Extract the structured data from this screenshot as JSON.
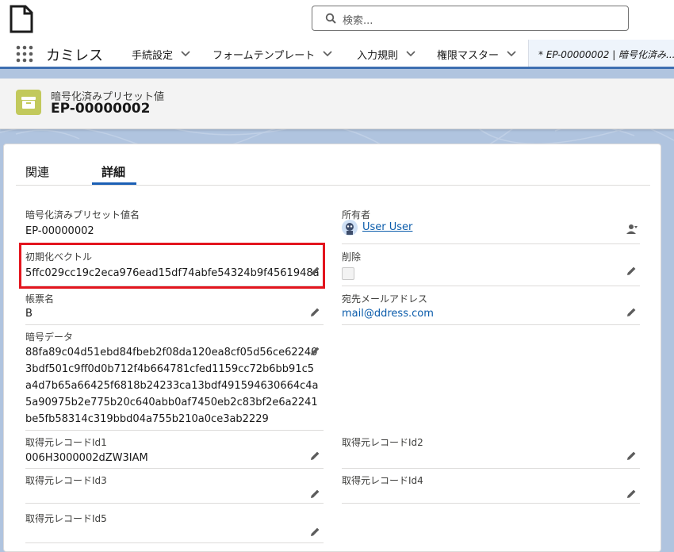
{
  "search": {
    "placeholder": "検索..."
  },
  "nav": {
    "app_name": "カミレス",
    "items": [
      {
        "label": "手続設定"
      },
      {
        "label": "フォームテンプレート"
      },
      {
        "label": "入力規則"
      },
      {
        "label": "権限マスター"
      }
    ],
    "active_tab": "* EP-00000002 | 暗号化済み..."
  },
  "record": {
    "object_label": "暗号化済みプリセット値",
    "name": "EP-00000002"
  },
  "tabs": [
    {
      "label": "関連"
    },
    {
      "label": "詳細"
    }
  ],
  "fields": {
    "preset_name": {
      "label": "暗号化済みプリセット値名",
      "value": "EP-00000002"
    },
    "owner": {
      "label": "所有者",
      "value": "User User"
    },
    "init_vector": {
      "label": "初期化ベクトル",
      "value": "5ffc029cc19c2eca976ead15df74abfe54324b9f4561948a"
    },
    "deleted": {
      "label": "削除"
    },
    "form_name": {
      "label": "帳票名",
      "value": "B"
    },
    "dest_email": {
      "label": "宛先メールアドレス",
      "value": "mail@ddress.com"
    },
    "encrypted_data": {
      "label": "暗号データ",
      "lines": [
        "88fa89c04d51ebd84fbeb2f08da120ea8cf05d56ce62240",
        "3bdf501c9ff0d0b712f4b664781cfed1159cc72b6bb91c5",
        "a4d7b65a66425f6818b24233ca13bdf491594630664c4a",
        "5a90975b2e775b20c640abb0af7450eb2c83bf2e6a2241",
        "be5fb58314c319bbd04a755b210a0ce3ab2229"
      ]
    },
    "source_id1": {
      "label": "取得元レコードId1",
      "value": "006H3000002dZW3IAM"
    },
    "source_id2": {
      "label": "取得元レコードId2"
    },
    "source_id3": {
      "label": "取得元レコードId3"
    },
    "source_id4": {
      "label": "取得元レコードId4"
    },
    "source_id5": {
      "label": "取得元レコードId5"
    }
  },
  "colors": {
    "brand_blue": "#0b5cab",
    "highlight_red": "#e3151e",
    "object_icon": "#c2c95c"
  }
}
